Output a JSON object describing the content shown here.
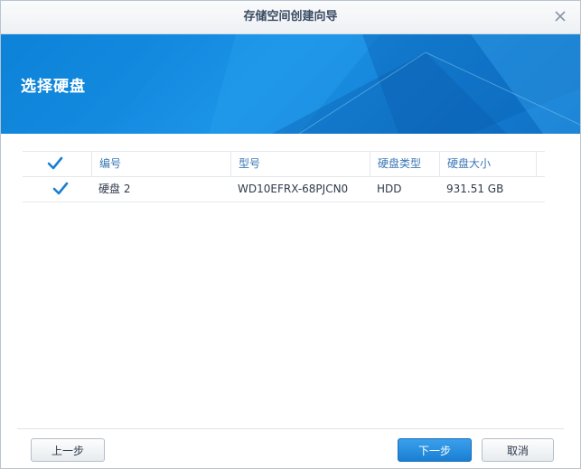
{
  "window": {
    "title": "存储空间创建向导"
  },
  "banner": {
    "heading": "选择硬盘"
  },
  "table": {
    "columns": [
      "编号",
      "型号",
      "硬盘类型",
      "硬盘大小"
    ],
    "rows": [
      {
        "checked": true,
        "number": "硬盘 2",
        "model": "WD10EFRX-68PJCN0",
        "type": "HDD",
        "size": "931.51 GB"
      }
    ]
  },
  "footer": {
    "prev_label": "上一步",
    "next_label": "下一步",
    "cancel_label": "取消"
  },
  "colors": {
    "accent": "#1b93e6",
    "check": "#1a7fd4",
    "header_text": "#3a77b5"
  }
}
